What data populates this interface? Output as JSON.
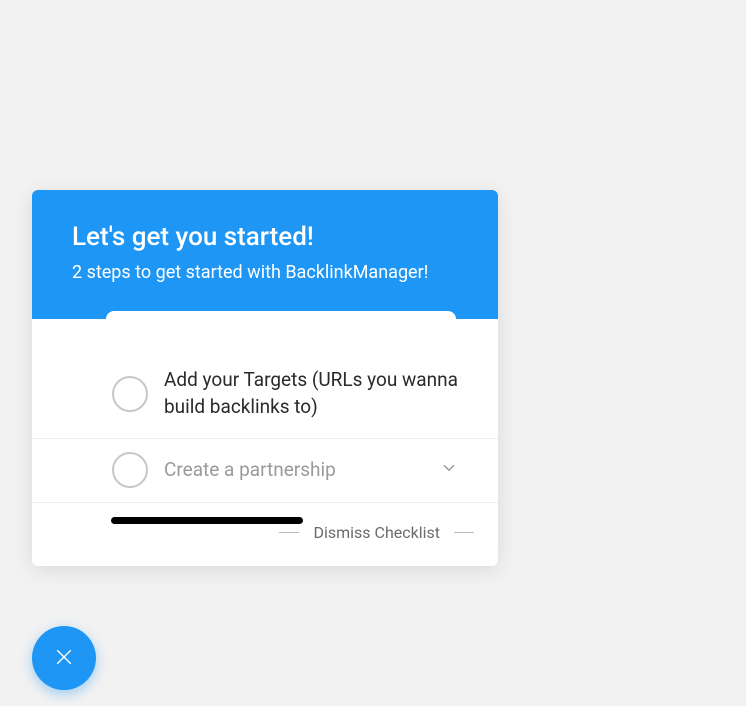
{
  "header": {
    "title": "Let's get you started!",
    "subtitle": "2 steps to get started with BacklinkManager!"
  },
  "items": [
    {
      "label": "Add your Targets (URLs you wanna build backlinks to)",
      "muted": false,
      "expandable": false
    },
    {
      "label": "Create a partnership",
      "muted": true,
      "expandable": true
    }
  ],
  "dismiss": {
    "label": "Dismiss Checklist"
  }
}
